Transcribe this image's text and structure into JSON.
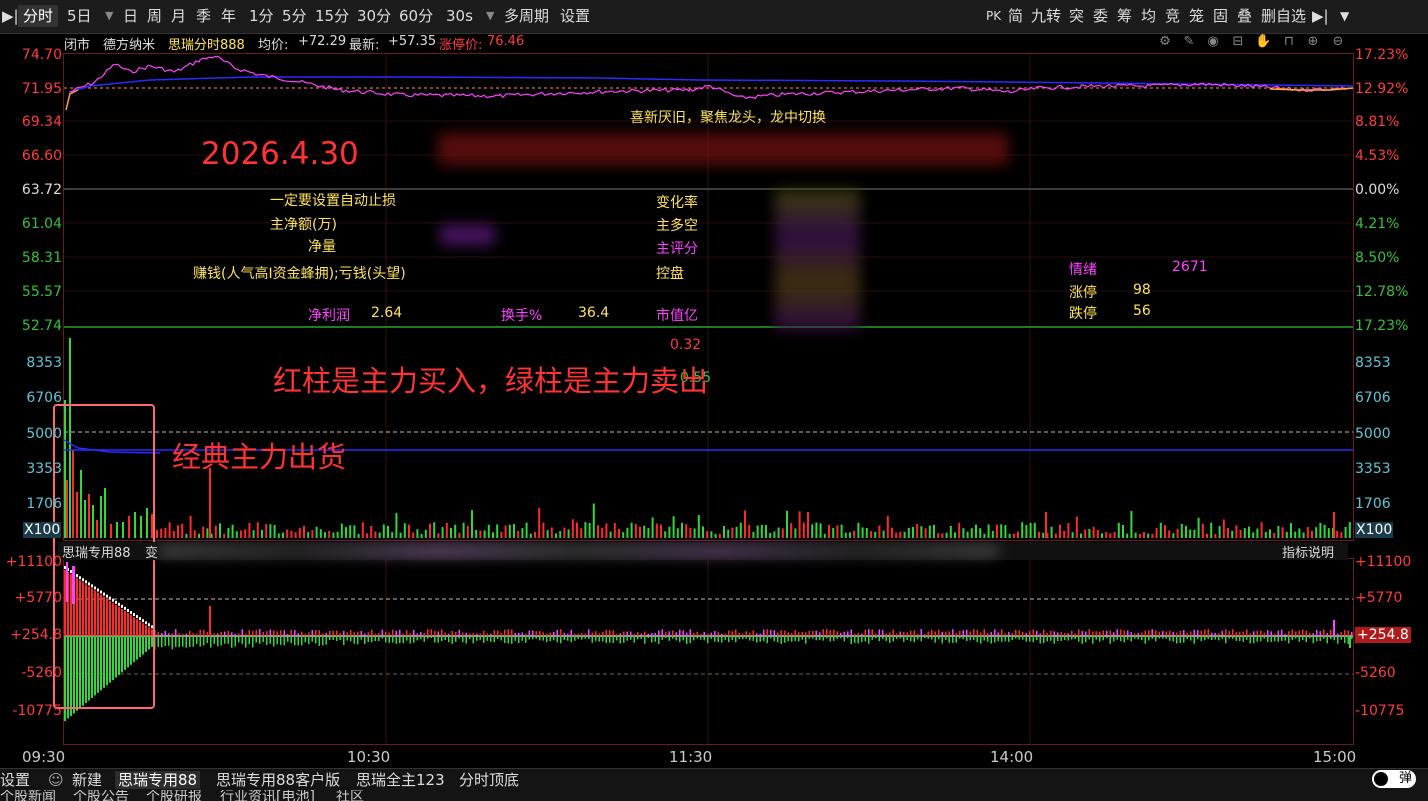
{
  "toolbar": {
    "left": [
      "分时",
      "5日",
      "日",
      "周",
      "月",
      "季",
      "年",
      "1分",
      "5分",
      "15分",
      "30分",
      "60分",
      "30s",
      "多周期",
      "设置"
    ],
    "active_index": 0,
    "right": [
      "PK",
      "简",
      "九转",
      "突",
      "委",
      "筹",
      "均",
      "竞",
      "笼",
      "固",
      "叠",
      "删自选"
    ]
  },
  "info": {
    "status": "闭市",
    "stock_name": "德方纳米",
    "indicator": "思瑞分时888",
    "avg_label": "均价:",
    "avg_value": "+72.29",
    "latest_label": "最新:",
    "latest_value": "+57.35",
    "limit_label": "涨停价:",
    "limit_value": "76.46"
  },
  "price_axis": {
    "left": [
      "74.70",
      "71.95",
      "69.34",
      "66.60",
      "63.72",
      "61.04",
      "58.31",
      "55.57",
      "52.74"
    ],
    "right": [
      "17.23%",
      "12.92%",
      "8.81%",
      "4.53%",
      "0.00%",
      "4.21%",
      "8.50%",
      "12.78%",
      "17.23%"
    ]
  },
  "volume_axis": {
    "labels": [
      "8353",
      "6706",
      "5000",
      "3353",
      "1706"
    ],
    "unit": "X100"
  },
  "indicator_axis": {
    "left": [
      "+11100",
      "+5770",
      "+254.8",
      "-5260",
      "-10775"
    ],
    "right": [
      "+11100",
      "+5770",
      "+254.8",
      "-5260",
      "-10775"
    ]
  },
  "panel2": {
    "title": "思瑞专用88",
    "title_suffix": "变",
    "help": "指标说明"
  },
  "overlay": {
    "slogan": "喜新厌旧，聚焦龙头，龙中切换",
    "date": "2026.4.30",
    "stop_loss": "一定要设置自动止损",
    "main_net": "主净额(万)",
    "net_vol": "净量",
    "money_text": "赚钱(人气高I资金蜂拥);亏钱(头望)",
    "change_rate": "变化率",
    "main_ls": "主多空",
    "main_score": "主评分",
    "control": "控盘",
    "profit_label": "净利润",
    "profit_value": "2.64",
    "turnover_label": "换手%",
    "turnover_value": "36.4",
    "mcap_label": "市值亿",
    "v1": "0.32",
    "v2": "0.55",
    "mood_label": "情绪",
    "mood_value": "2671",
    "up_label": "涨停",
    "up_value": "98",
    "down_label": "跌停",
    "down_value": "56",
    "annotation_bars": "红柱是主力买入，绿柱是主力卖出",
    "annotation_box": "经典主力出货"
  },
  "time_axis": [
    "09:30",
    "10:30",
    "11:30",
    "14:00",
    "15:00"
  ],
  "bottom_tabs": [
    "设置",
    "新建",
    "思瑞专用88",
    "思瑞专用88客户版",
    "思瑞全主123",
    "分时顶底"
  ],
  "bottom_active": 2,
  "popup_label": "弹",
  "news_tabs": [
    "个股新闻",
    "个股公告",
    "个股研报",
    "行业资讯[电池]",
    "社区"
  ],
  "colors": {
    "up": "#ff3b3b",
    "down": "#31c23a",
    "avg_line": "#2b2bff",
    "price_line": "#ff40ff",
    "highlight_box": "#ff6b6b"
  }
}
